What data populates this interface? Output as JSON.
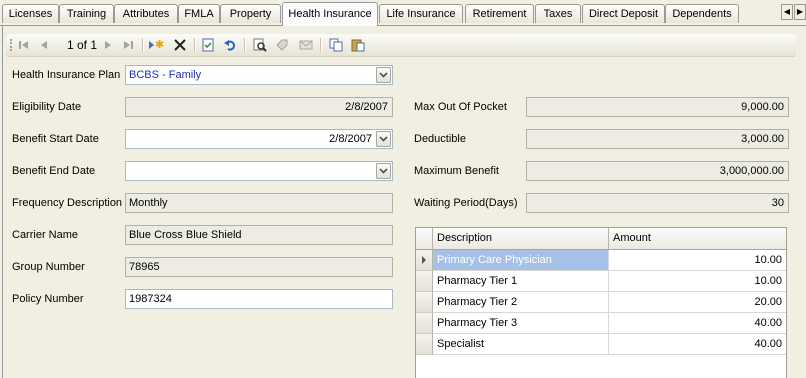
{
  "tabs": [
    {
      "label": "Licenses",
      "active": false
    },
    {
      "label": "Training",
      "active": false
    },
    {
      "label": "Attributes",
      "active": false
    },
    {
      "label": "FMLA",
      "active": false
    },
    {
      "label": "Property",
      "active": false
    },
    {
      "label": "Health Insurance",
      "active": true
    },
    {
      "label": "Life Insurance",
      "active": false
    },
    {
      "label": "Retirement",
      "active": false
    },
    {
      "label": "Taxes",
      "active": false
    },
    {
      "label": "Direct Deposit",
      "active": false
    },
    {
      "label": "Dependents",
      "active": false
    }
  ],
  "toolbar": {
    "position_text": "1 of 1",
    "icons": [
      "first-record-icon",
      "previous-record-icon",
      "next-record-icon",
      "last-record-icon",
      "new-record-icon",
      "delete-icon",
      "save-icon",
      "undo-icon",
      "preview-icon",
      "tag-icon",
      "mail-icon",
      "copy-icon",
      "paste-icon"
    ]
  },
  "form": {
    "plan": {
      "label": "Health Insurance Plan",
      "value": "BCBS - Family"
    },
    "eligibility_date": {
      "label": "Eligibility Date",
      "value": "2/8/2007"
    },
    "benefit_start": {
      "label": "Benefit Start Date",
      "value": "2/8/2007"
    },
    "benefit_end": {
      "label": "Benefit End Date",
      "value": ""
    },
    "frequency": {
      "label": "Frequency Description",
      "value": "Monthly"
    },
    "carrier": {
      "label": "Carrier Name",
      "value": "Blue Cross Blue Shield"
    },
    "group_number": {
      "label": "Group Number",
      "value": "78965"
    },
    "policy_number": {
      "label": "Policy Number",
      "value": "1987324"
    },
    "max_out_of_pocket": {
      "label": "Max Out Of Pocket",
      "value": "9,000.00"
    },
    "deductible": {
      "label": "Deductible",
      "value": "3,000.00"
    },
    "maximum_benefit": {
      "label": "Maximum Benefit",
      "value": "3,000,000.00"
    },
    "waiting_period": {
      "label": "Waiting Period(Days)",
      "value": "30"
    }
  },
  "grid": {
    "columns": [
      "Description",
      "Amount"
    ],
    "rows": [
      {
        "description": "Primary Care Physician",
        "amount": "10.00",
        "selected": true
      },
      {
        "description": "Pharmacy Tier 1",
        "amount": "10.00",
        "selected": false
      },
      {
        "description": "Pharmacy Tier 2",
        "amount": "20.00",
        "selected": false
      },
      {
        "description": "Pharmacy Tier 3",
        "amount": "40.00",
        "selected": false
      },
      {
        "description": "Specialist",
        "amount": "40.00",
        "selected": false
      }
    ]
  },
  "colors": {
    "selection": "#a6c0e8",
    "combo_text": "#1f2fb8",
    "panel": "#f1efe2"
  }
}
